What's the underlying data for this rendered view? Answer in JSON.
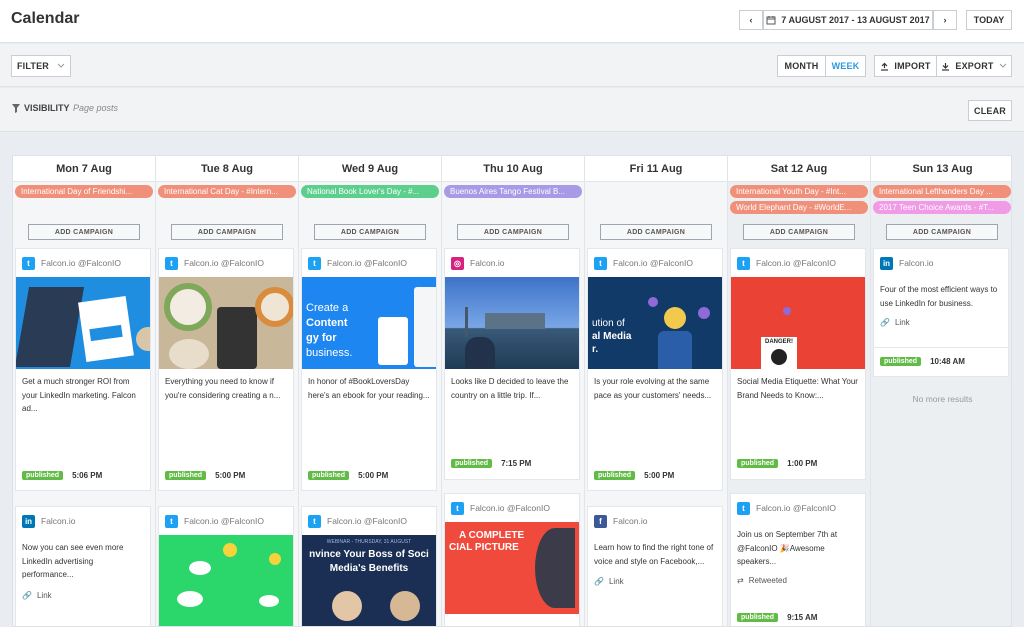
{
  "header": {
    "title": "Calendar",
    "prev_label": "‹",
    "next_label": "›",
    "date_range": "7 AUGUST 2017 - 13 AUGUST 2017",
    "today_label": "TODAY"
  },
  "toolbar": {
    "filter_label": "FILTER",
    "month_label": "MONTH",
    "week_label": "WEEK",
    "import_label": "IMPORT",
    "export_label": "EXPORT"
  },
  "visibility": {
    "label": "VISIBILITY",
    "value": "Page posts",
    "clear_label": "CLEAR"
  },
  "add_campaign_label": "ADD CAMPAIGN",
  "no_more_label": "No more results",
  "colors": {
    "accent": "#2d9bd9",
    "published": "#62bb46",
    "event_orange": "#f0907a",
    "event_green": "#5ccf8d",
    "event_purple": "#a89ae6",
    "event_pink": "#f19ae6",
    "twitter": "#1da1f2",
    "linkedin": "#0077b5",
    "facebook": "#3b5998",
    "instagram": "#d6247e"
  },
  "days": [
    {
      "label": "Mon 7 Aug",
      "events": [
        {
          "text": "International Day of Friendshi...",
          "color": "#f0907a"
        }
      ],
      "cards": [
        {
          "network": "twitter",
          "account": "Falcon.io @FalconIO",
          "text": "Get a much stronger ROI from your LinkedIn marketing. Falcon ad...",
          "status": "published",
          "time": "5:06 PM"
        },
        {
          "network": "linkedin",
          "account": "Falcon.io",
          "text": "Now you can see even more LinkedIn advertising performance...",
          "link": "Link"
        }
      ]
    },
    {
      "label": "Tue 8 Aug",
      "events": [
        {
          "text": "International Cat Day - #Intern...",
          "color": "#f0907a"
        }
      ],
      "cards": [
        {
          "network": "twitter",
          "account": "Falcon.io @FalconIO",
          "text": "Everything you need to know if you're considering creating a n...",
          "status": "published",
          "time": "5:00 PM"
        },
        {
          "network": "twitter",
          "account": "Falcon.io @FalconIO"
        }
      ]
    },
    {
      "label": "Wed 9 Aug",
      "events": [
        {
          "text": "National Book Lover's Day - #...",
          "color": "#5ccf8d"
        }
      ],
      "cards": [
        {
          "network": "twitter",
          "account": "Falcon.io @FalconIO",
          "img_line1": "Create a",
          "img_line2": "Content",
          "img_line3": "gy for",
          "img_line4": "business.",
          "text": "In honor of #BookLoversDay here's an ebook for your reading...",
          "status": "published",
          "time": "5:00 PM"
        },
        {
          "network": "twitter",
          "account": "Falcon.io @FalconIO",
          "img_line1": "WEBINAR - THURSDAY, 31 AUGUST",
          "img_line2": "nvince Your Boss of Soci",
          "img_line3": "Media's Benefits"
        }
      ]
    },
    {
      "label": "Thu 10 Aug",
      "events": [
        {
          "text": "Buenos Aires Tango Festival B...",
          "color": "#a89ae6"
        }
      ],
      "cards": [
        {
          "network": "instagram",
          "account": "Falcon.io",
          "text": "Looks like D decided to leave the country on a little trip. If...",
          "status": "published",
          "time": "7:15 PM"
        },
        {
          "network": "twitter",
          "account": "Falcon.io @FalconIO",
          "img_line1": "A COMPLETE",
          "img_line2": "CIAL PICTURE"
        }
      ]
    },
    {
      "label": "Fri 11 Aug",
      "events": [],
      "cards": [
        {
          "network": "twitter",
          "account": "Falcon.io @FalconIO",
          "img_line1": "ution of",
          "img_line2": "al Media",
          "img_line3": "r.",
          "text": "Is your role evolving at the same pace as your customers' needs...",
          "status": "published",
          "time": "5:00 PM"
        },
        {
          "network": "facebook",
          "account": "Falcon.io",
          "text": "Learn how to find the right tone of voice and style on Facebook,...",
          "link": "Link"
        }
      ]
    },
    {
      "label": "Sat 12 Aug",
      "events": [
        {
          "text": "International Youth Day - #Int...",
          "color": "#f0907a"
        },
        {
          "text": "World Elephant Day - #WorldE...",
          "color": "#f0907a"
        }
      ],
      "cards": [
        {
          "network": "twitter",
          "account": "Falcon.io @FalconIO",
          "img_line1": "DANGER!",
          "text": "Social Media Etiquette: What Your Brand Needs to Know:...",
          "status": "published",
          "time": "1:00 PM"
        },
        {
          "network": "twitter",
          "account": "Falcon.io @FalconIO",
          "text": "Join us on September 7th at @FalconIO 🎉Awesome speakers...",
          "retweet": "Retweeted",
          "status": "published",
          "time": "9:15 AM"
        }
      ]
    },
    {
      "label": "Sun 13 Aug",
      "events": [
        {
          "text": "International Lefthanders Day ...",
          "color": "#f0907a"
        },
        {
          "text": "2017 Teen Choice Awards - #T...",
          "color": "#f19ae6"
        }
      ],
      "cards": [
        {
          "network": "linkedin",
          "account": "Falcon.io",
          "text": "Four of the most efficient ways to use LinkedIn for business.",
          "link": "Link",
          "status": "published",
          "time": "10:48 AM"
        }
      ]
    }
  ]
}
